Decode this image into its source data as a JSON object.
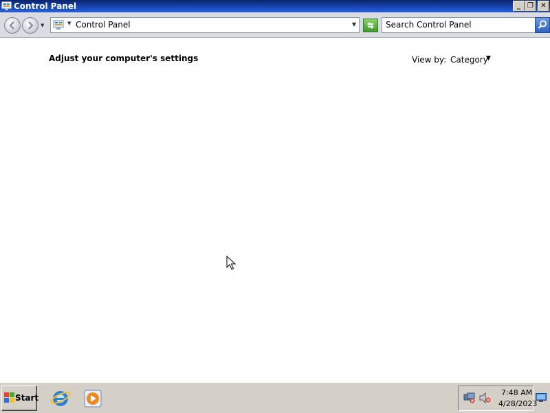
{
  "window": {
    "title": "Control Panel",
    "minimize_label": "_",
    "maximize_label": "❐",
    "close_label": "✕"
  },
  "navbar": {
    "address_text": "Control Panel",
    "search_placeholder": "Search Control Panel",
    "search_value": ""
  },
  "content": {
    "heading": "Adjust your computer's settings",
    "view_by_label": "View by:",
    "view_by_value": "Category"
  },
  "taskbar": {
    "start_label": "Start",
    "pinned": [
      "internet-explorer-icon",
      "windows-media-player-icon"
    ],
    "clock_time": "7:48 AM",
    "clock_date": "4/28/2023",
    "tray_icons": [
      "network-disconnected-icon",
      "volume-muted-icon"
    ]
  },
  "colors": {
    "titlebar": "#0a246a",
    "taskbar": "#d4d0c8",
    "navbar": "#d9dde3",
    "background": "#ffffff"
  }
}
